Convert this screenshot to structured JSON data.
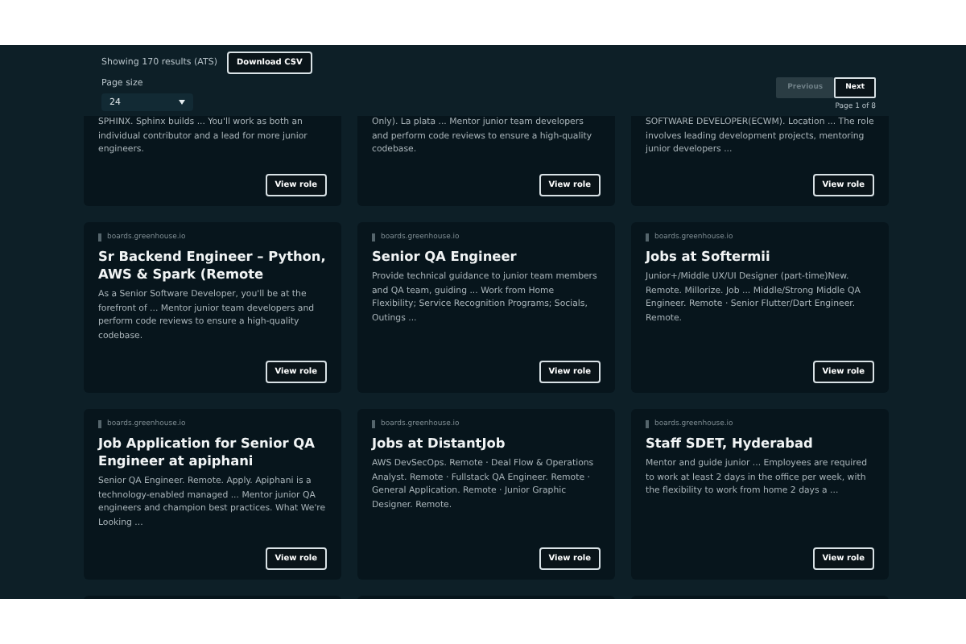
{
  "results": {
    "summary": "Showing 170 results (ATS)",
    "download_button": "Download CSV",
    "page_size_label": "Page size",
    "page_size": "24"
  },
  "pagination": {
    "previous": "Previous",
    "previous_disabled": true,
    "next": "Next",
    "page_info": "Page 1 of 8"
  },
  "partial_cards": [
    {
      "description": "SPHINX. Sphinx builds ... You'll work as both an individual contributor and a lead for more junior engineers.",
      "button": "View role"
    },
    {
      "description": "Only). La plata ... Mentor junior team developers and perform code reviews to ensure a high-quality codebase.",
      "button": "View role"
    },
    {
      "description": "SOFTWARE DEVELOPER(ECWM). Location ... The role involves leading development projects, mentoring junior developers ...",
      "button": "View role"
    }
  ],
  "cards": [
    {
      "source": "boards.greenhouse.io",
      "title": "Sr Backend Engineer – Python, AWS & Spark (Remote",
      "description": "As a Senior Software Developer, you'll be at the forefront of ... Mentor junior team developers and perform code reviews to ensure a high-quality codebase.",
      "button": "View role"
    },
    {
      "source": "boards.greenhouse.io",
      "title": "Senior QA Engineer",
      "description": "Provide technical guidance to junior team members and QA team, guiding ... Work from Home Flexibility; Service Recognition Programs; Socials, Outings ...",
      "button": "View role"
    },
    {
      "source": "boards.greenhouse.io",
      "title": "Jobs at Softermii",
      "description": "Junior+/Middle UX/UI Designer (part-time)New. Remote. Millorize. Job ... Middle/Strong Middle QA Engineer. Remote · Senior Flutter/Dart Engineer. Remote.",
      "button": "View role"
    },
    {
      "source": "boards.greenhouse.io",
      "title": "Job Application for Senior QA Engineer at apiphani",
      "description": "Senior QA Engineer. Remote. Apply. Apiphani is a technology-enabled managed ... Mentor junior QA engineers and champion best practices. What We're Looking ...",
      "button": "View role"
    },
    {
      "source": "boards.greenhouse.io",
      "title": "Jobs at DistantJob",
      "description": "AWS DevSecOps. Remote · Deal Flow & Operations Analyst. Remote · Fullstack QA Engineer. Remote · General Application. Remote · Junior Graphic Designer. Remote.",
      "button": "View role"
    },
    {
      "source": "boards.greenhouse.io",
      "title": "Staff SDET, Hyderabad",
      "description": "Mentor and guide junior ... Employees are required to work at least 2 days in the office per week, with the flexibility to work from home 2 days a ...",
      "button": "View role"
    }
  ]
}
